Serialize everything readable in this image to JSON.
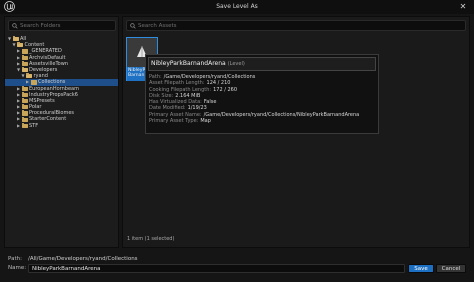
{
  "window": {
    "title": "Save Level As"
  },
  "left": {
    "search_placeholder": "Search Folders",
    "tree": [
      {
        "label": "All",
        "depth": 0,
        "open": true,
        "selected": false
      },
      {
        "label": "Content",
        "depth": 1,
        "open": true,
        "selected": false
      },
      {
        "label": "_GENERATED",
        "depth": 2,
        "open": false,
        "selected": false
      },
      {
        "label": "ArchvisDefault",
        "depth": 2,
        "open": false,
        "selected": false
      },
      {
        "label": "AssetsvilleTown",
        "depth": 2,
        "open": false,
        "selected": false
      },
      {
        "label": "Developers",
        "depth": 2,
        "open": true,
        "selected": false
      },
      {
        "label": "ryand",
        "depth": 3,
        "open": true,
        "selected": false
      },
      {
        "label": "Collections",
        "depth": 4,
        "open": false,
        "selected": true
      },
      {
        "label": "EuropeanHornbeam",
        "depth": 2,
        "open": false,
        "selected": false
      },
      {
        "label": "IndustryPropsPack6",
        "depth": 2,
        "open": false,
        "selected": false
      },
      {
        "label": "MSPresets",
        "depth": 2,
        "open": false,
        "selected": false
      },
      {
        "label": "Polar",
        "depth": 2,
        "open": false,
        "selected": false
      },
      {
        "label": "ProceduralBiomes",
        "depth": 2,
        "open": false,
        "selected": false
      },
      {
        "label": "StarterContent",
        "depth": 2,
        "open": false,
        "selected": false
      },
      {
        "label": "STF",
        "depth": 2,
        "open": false,
        "selected": false
      }
    ]
  },
  "right": {
    "search_placeholder": "Search Assets",
    "asset_tile_name": "NibleyPark Barnan",
    "item_count": "1 item (1 selected)"
  },
  "tooltip": {
    "name": "NibleyParkBarnandArena",
    "kind": "(Level)",
    "rows": [
      {
        "key": "Path:",
        "value": "/Game/Developers/ryand/Collections"
      },
      {
        "key": "Asset Filepath Length:",
        "value": "124 / 210"
      },
      {
        "key": "Cooking Filepath Length:",
        "value": "172 / 260"
      },
      {
        "key": "Disk Size:",
        "value": "2.164 MiB"
      },
      {
        "key": "Has Virtualized Data:",
        "value": "False"
      },
      {
        "key": "Date Modified:",
        "value": "1/19/23"
      },
      {
        "key": "Primary Asset Name:",
        "value": "/Game/Developers/ryand/Collections/NibleyParkBarnandArena"
      },
      {
        "key": "Primary Asset Type:",
        "value": "Map"
      }
    ]
  },
  "footer": {
    "path_label": "Path:",
    "path_value": "/All/Game/Developers/ryand/Collections",
    "name_label": "Name:",
    "name_value": "NibleyParkBarnandArena",
    "save_label": "Save",
    "cancel_label": "Cancel"
  },
  "colors": {
    "accent": "#1d6fc2",
    "folder": "#c9a55a",
    "selection": "#1f4f8a"
  }
}
